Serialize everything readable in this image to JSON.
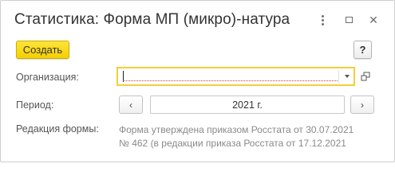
{
  "window": {
    "title": "Статистика: Форма МП (микро)-натура",
    "more_icon": "more-vertical-icon",
    "maximize_icon": "maximize-icon",
    "close_icon": "close-icon",
    "close_glyph": "✕"
  },
  "toolbar": {
    "create_label": "Создать",
    "help_label": "?"
  },
  "fields": {
    "organization": {
      "label": "Организация:",
      "value": ""
    },
    "period": {
      "label": "Период:",
      "value": "2021 г.",
      "prev_glyph": "‹",
      "next_glyph": "›"
    },
    "form_edition": {
      "label": "Редакция формы:",
      "line1": "Форма утверждена приказом Росстата от 30.07.2021",
      "line2": "№ 462 (в редакции приказа Росстата от 17.12.2021"
    }
  },
  "colors": {
    "accent": "#F5D000",
    "focus_border": "#F2CF3A",
    "text": "#333333",
    "muted": "#8A8A8A"
  }
}
